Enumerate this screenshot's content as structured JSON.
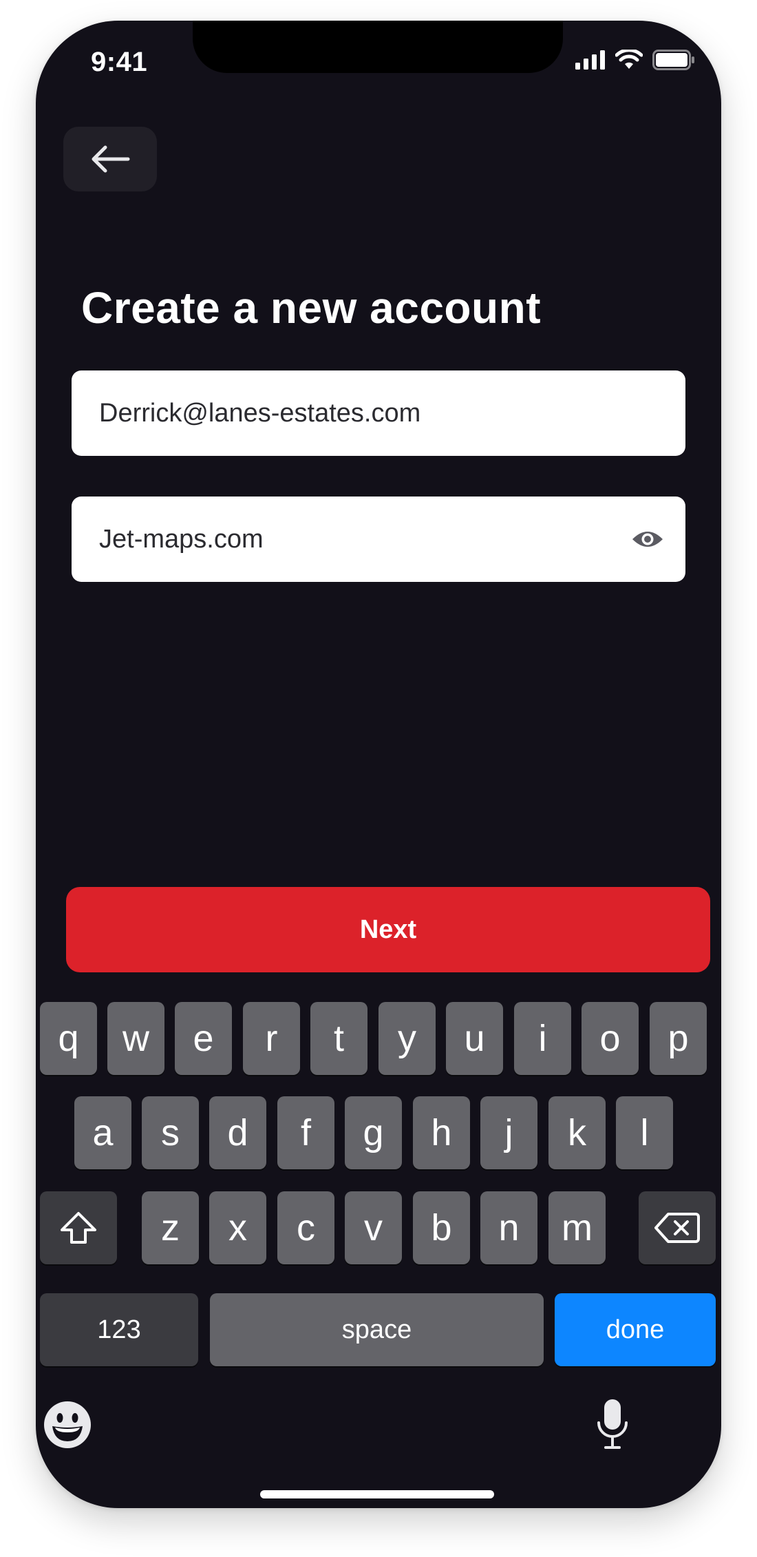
{
  "status_bar": {
    "time": "9:41"
  },
  "header": {
    "title": "Create a new account"
  },
  "form": {
    "email_value": "Derrick@lanes-estates.com",
    "password_value": "Jet-maps.com"
  },
  "actions": {
    "next_label": "Next"
  },
  "keyboard": {
    "row1": [
      "q",
      "w",
      "e",
      "r",
      "t",
      "y",
      "u",
      "i",
      "o",
      "p"
    ],
    "row2": [
      "a",
      "s",
      "d",
      "f",
      "g",
      "h",
      "j",
      "k",
      "l"
    ],
    "row3": [
      "z",
      "x",
      "c",
      "v",
      "b",
      "n",
      "m"
    ],
    "numbers_label": "123",
    "space_label": "space",
    "done_label": "done"
  },
  "colors": {
    "background": "#121019",
    "accent": "#dc222a",
    "done_key": "#0d86ff",
    "key": "#646469"
  },
  "icons": [
    "back-arrow-icon",
    "eye-icon",
    "signal-icon",
    "wifi-icon",
    "battery-icon",
    "shift-icon",
    "backspace-icon",
    "emoji-icon",
    "microphone-icon"
  ]
}
